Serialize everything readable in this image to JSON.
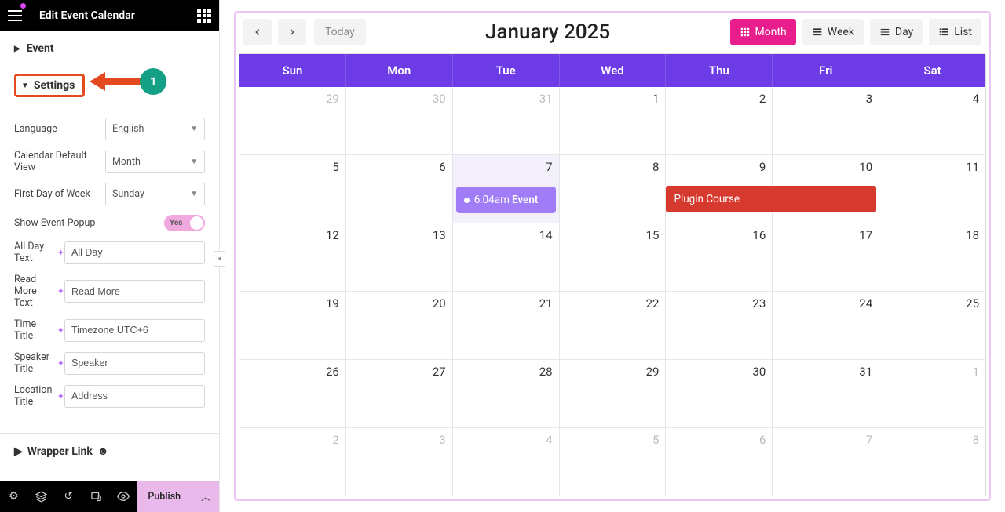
{
  "header": {
    "title": "Edit Event Calendar"
  },
  "sections": {
    "event": "Event",
    "settings": "Settings",
    "wrapper_link": "Wrapper Link"
  },
  "annotation": {
    "badge": "1"
  },
  "settings": {
    "language": {
      "label": "Language",
      "value": "English"
    },
    "default_view": {
      "label": "Calendar Default View",
      "value": "Month"
    },
    "first_day": {
      "label": "First Day of Week",
      "value": "Sunday"
    },
    "show_popup": {
      "label": "Show Event Popup",
      "value": "Yes"
    },
    "all_day": {
      "label": "All Day Text",
      "value": "All Day"
    },
    "read_more": {
      "label": "Read More Text",
      "value": "Read More"
    },
    "time_title": {
      "label": "Time Title",
      "value": "Timezone UTC+6"
    },
    "speaker_title": {
      "label": "Speaker Title",
      "value": "Speaker"
    },
    "location_title": {
      "label": "Location Title",
      "value": "Address"
    }
  },
  "footer": {
    "publish": "Publish"
  },
  "calendar": {
    "today_label": "Today",
    "title": "January 2025",
    "views": {
      "month": "Month",
      "week": "Week",
      "day": "Day",
      "list": "List"
    },
    "day_headers": [
      "Sun",
      "Mon",
      "Tue",
      "Wed",
      "Thu",
      "Fri",
      "Sat"
    ],
    "weeks": [
      [
        {
          "n": "29",
          "other": true
        },
        {
          "n": "30",
          "other": true
        },
        {
          "n": "31",
          "other": true
        },
        {
          "n": "1"
        },
        {
          "n": "2"
        },
        {
          "n": "3"
        },
        {
          "n": "4"
        }
      ],
      [
        {
          "n": "5"
        },
        {
          "n": "6"
        },
        {
          "n": "7",
          "today": true
        },
        {
          "n": "8"
        },
        {
          "n": "9"
        },
        {
          "n": "10"
        },
        {
          "n": "11"
        }
      ],
      [
        {
          "n": "12"
        },
        {
          "n": "13"
        },
        {
          "n": "14"
        },
        {
          "n": "15"
        },
        {
          "n": "16"
        },
        {
          "n": "17"
        },
        {
          "n": "18"
        }
      ],
      [
        {
          "n": "19"
        },
        {
          "n": "20"
        },
        {
          "n": "21"
        },
        {
          "n": "22"
        },
        {
          "n": "23"
        },
        {
          "n": "24"
        },
        {
          "n": "25"
        }
      ],
      [
        {
          "n": "26"
        },
        {
          "n": "27"
        },
        {
          "n": "28"
        },
        {
          "n": "29"
        },
        {
          "n": "30"
        },
        {
          "n": "31"
        },
        {
          "n": "1",
          "other": true
        }
      ],
      [
        {
          "n": "2",
          "other": true
        },
        {
          "n": "3",
          "other": true
        },
        {
          "n": "4",
          "other": true
        },
        {
          "n": "5",
          "other": true
        },
        {
          "n": "6",
          "other": true
        },
        {
          "n": "7",
          "other": true
        },
        {
          "n": "8",
          "other": true
        }
      ]
    ],
    "events": {
      "purple": {
        "time": "6:04am",
        "title": "Event"
      },
      "red": {
        "title": "Plugin Course"
      }
    }
  }
}
